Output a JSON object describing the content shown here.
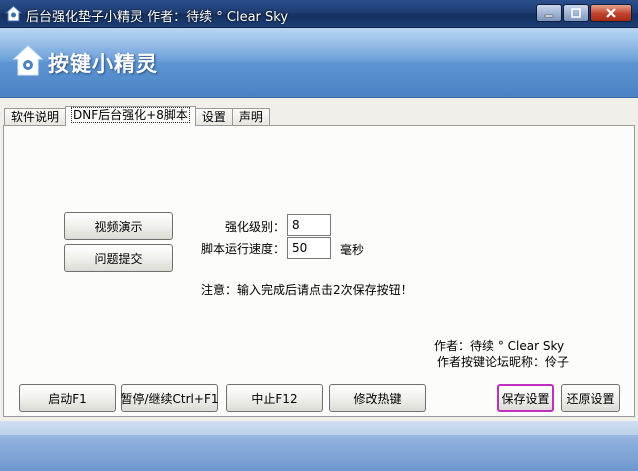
{
  "window": {
    "title": "后台强化垫子小精灵  作者：待续 ° Clear Sky"
  },
  "banner": {
    "logo_text": "按键小精灵"
  },
  "tabs": [
    {
      "label": "软件说明"
    },
    {
      "label": "DNF后台强化+8脚本"
    },
    {
      "label": "设置"
    },
    {
      "label": "声明"
    }
  ],
  "panel": {
    "video_button": "视频演示",
    "feedback_button": "问题提交",
    "level_label": "强化级别：",
    "level_value": "8",
    "speed_label": "脚本运行速度：",
    "speed_value": "50",
    "speed_unit": "毫秒",
    "notice": "注意：输入完成后请点击2次保存按钮！",
    "author_line": "作者：待续 ° Clear Sky",
    "forum_line": "作者按键论坛昵称：伶子"
  },
  "buttons": {
    "start": "启动F1",
    "pause": "暂停/继续Ctrl+F1",
    "stop": "中止F12",
    "hotkey": "修改热键",
    "save": "保存设置",
    "restore": "还原设置"
  },
  "colors": {
    "titlebar": "#1e3d73",
    "banner": "#5d95d3",
    "focus_border": "#c030c0"
  }
}
